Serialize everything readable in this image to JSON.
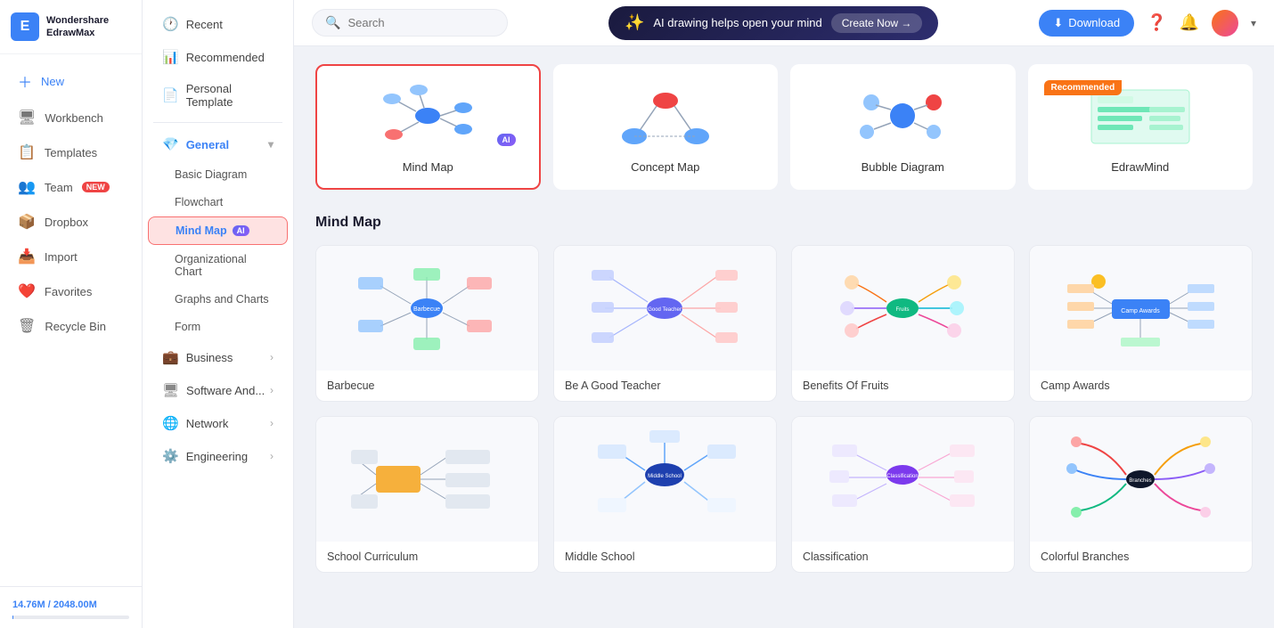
{
  "app": {
    "name": "Wondershare",
    "subtitle": "EdrawMax",
    "logo_char": "E"
  },
  "sidebar": {
    "items": [
      {
        "id": "new",
        "label": "New",
        "icon": "➕",
        "badge": null
      },
      {
        "id": "workbench",
        "label": "Workbench",
        "icon": "🖥",
        "badge": null
      },
      {
        "id": "templates",
        "label": "Templates",
        "icon": "📋",
        "badge": null
      },
      {
        "id": "team",
        "label": "Team",
        "icon": "👥",
        "badge": "NEW"
      },
      {
        "id": "dropbox",
        "label": "Dropbox",
        "icon": "📦",
        "badge": null
      },
      {
        "id": "import",
        "label": "Import",
        "icon": "📥",
        "badge": null
      },
      {
        "id": "favorites",
        "label": "Favorites",
        "icon": "❤️",
        "badge": null
      },
      {
        "id": "recycle",
        "label": "Recycle Bin",
        "icon": "🗑",
        "badge": null
      }
    ],
    "storage": {
      "used": "14.76M",
      "total": "2048.00M",
      "percent": 1
    }
  },
  "second_sidebar": {
    "items": [
      {
        "id": "recent",
        "label": "Recent",
        "icon": "🕐",
        "has_arrow": false
      },
      {
        "id": "recommended",
        "label": "Recommended",
        "icon": "📊",
        "has_arrow": false
      },
      {
        "id": "personal",
        "label": "Personal Template",
        "icon": "📄",
        "has_arrow": false
      },
      {
        "id": "general",
        "label": "General",
        "icon": "💎",
        "is_active": true,
        "has_arrow": true
      },
      {
        "id": "business",
        "label": "Business",
        "icon": "💼",
        "has_arrow": true
      },
      {
        "id": "software",
        "label": "Software And...",
        "icon": "🖥",
        "has_arrow": true
      },
      {
        "id": "network",
        "label": "Network",
        "icon": "🌐",
        "has_arrow": true
      },
      {
        "id": "engineering",
        "label": "Engineering",
        "icon": "⚙️",
        "has_arrow": true
      }
    ],
    "sub_items": [
      {
        "id": "basic-diagram",
        "label": "Basic Diagram"
      },
      {
        "id": "flowchart",
        "label": "Flowchart"
      },
      {
        "id": "mind-map",
        "label": "Mind Map",
        "is_active": true,
        "ai": true
      },
      {
        "id": "org-chart",
        "label": "Organizational Chart"
      },
      {
        "id": "graphs",
        "label": "Graphs and Charts"
      },
      {
        "id": "form",
        "label": "Form"
      }
    ]
  },
  "topbar": {
    "search_placeholder": "Search",
    "ai_banner_text": "AI drawing helps open your mind",
    "ai_banner_btn": "Create Now →",
    "download_btn": "Download"
  },
  "diagram_types": [
    {
      "id": "mind-map",
      "label": "Mind Map",
      "selected": true,
      "ai_badge": "AI"
    },
    {
      "id": "concept-map",
      "label": "Concept Map",
      "selected": false
    },
    {
      "id": "bubble-diagram",
      "label": "Bubble Diagram",
      "selected": false
    },
    {
      "id": "edrawmind",
      "label": "EdrawMind",
      "selected": false,
      "recommended": "Recommended"
    }
  ],
  "mind_map_section": {
    "title": "Mind Map",
    "templates": [
      {
        "id": "barbecue",
        "label": "Barbecue"
      },
      {
        "id": "good-teacher",
        "label": "Be A Good Teacher"
      },
      {
        "id": "fruits",
        "label": "Benefits Of Fruits"
      },
      {
        "id": "camp-awards",
        "label": "Camp Awards"
      }
    ],
    "more_templates": [
      {
        "id": "template5",
        "label": "School Curriculum"
      },
      {
        "id": "template6",
        "label": "Middle School"
      },
      {
        "id": "template7",
        "label": "Classification"
      },
      {
        "id": "template8",
        "label": "Colorful Branches"
      }
    ]
  }
}
